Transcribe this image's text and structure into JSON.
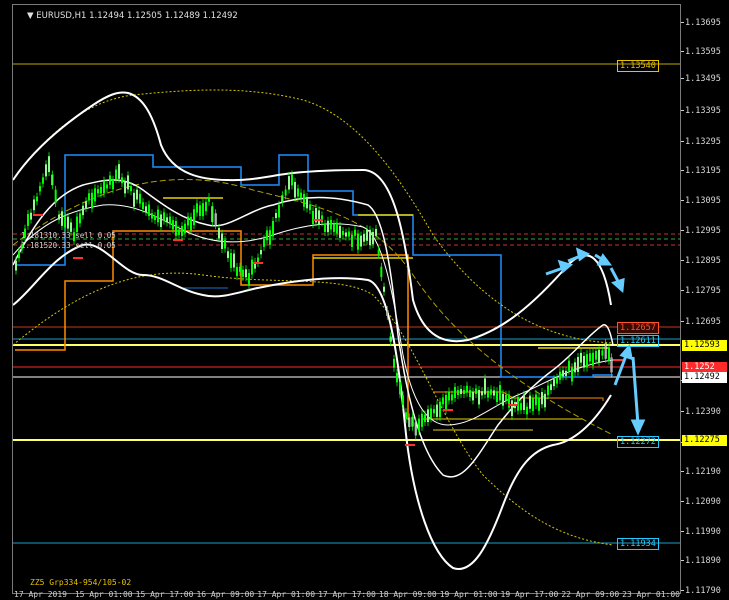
{
  "header": {
    "arrow": "▼",
    "symbol_label": "EURUSD,H1",
    "ohlc": "1.12494 1.12505 1.12489 1.12492",
    "close_glyph": ")"
  },
  "price_axis": {
    "labels": [
      "1.13695",
      "1.13595",
      "1.13495",
      "1.13395",
      "1.13295",
      "1.13195",
      "1.13095",
      "1.12995",
      "1.12895",
      "1.12795",
      "1.12695",
      "1.12590",
      "1.12390",
      "1.12275",
      "1.12190",
      "1.12090",
      "1.11990",
      "1.11890",
      "1.11790"
    ],
    "tags": [
      {
        "text": "1.12593",
        "bg": "#ffff00",
        "fg": "#000000"
      },
      {
        "text": "1.1252",
        "bg": "#ff2a2a",
        "fg": "#ffffff"
      },
      {
        "text": "1.12492",
        "bg": "#ffffff",
        "fg": "#000000"
      },
      {
        "text": "1.12275",
        "bg": "#ffff00",
        "fg": "#000000"
      }
    ]
  },
  "level_tags": [
    {
      "text": "1.13540",
      "color": "#e6c200"
    },
    {
      "text": "1.12657",
      "color": "#ff5533"
    },
    {
      "text": "1.12611",
      "color": "#28c8ff"
    },
    {
      "text": "1.12272",
      "color": "#28c8ff"
    },
    {
      "text": "1.11934",
      "color": "#28c8ff"
    }
  ],
  "notes": {
    "line1": "1.181310.33 sell 0.05",
    "line2": "1.181520.33 sell 0.05",
    "footer": "ZZ5 Grp334-954/105-02"
  },
  "time_axis": [
    "17 Apr 2019",
    "15 Apr 01:00",
    "15 Apr 17:00",
    "16 Apr 09:00",
    "17 Apr 01:00",
    "17 Apr 17:00",
    "18 Apr 09:00",
    "19 Apr 01:00",
    "19 Apr 17:00",
    "22 Apr 09:00",
    "23 Apr 01:00"
  ],
  "colors": {
    "background": "#000000",
    "candle_up": "#00ff00",
    "bollinger": "#ffffff",
    "envelope": "#d4c700",
    "channel_blue": "#1e90ff",
    "channel_orange": "#ff8c00",
    "support_yellow": "#ffff66",
    "arrow": "#66ccff"
  }
}
